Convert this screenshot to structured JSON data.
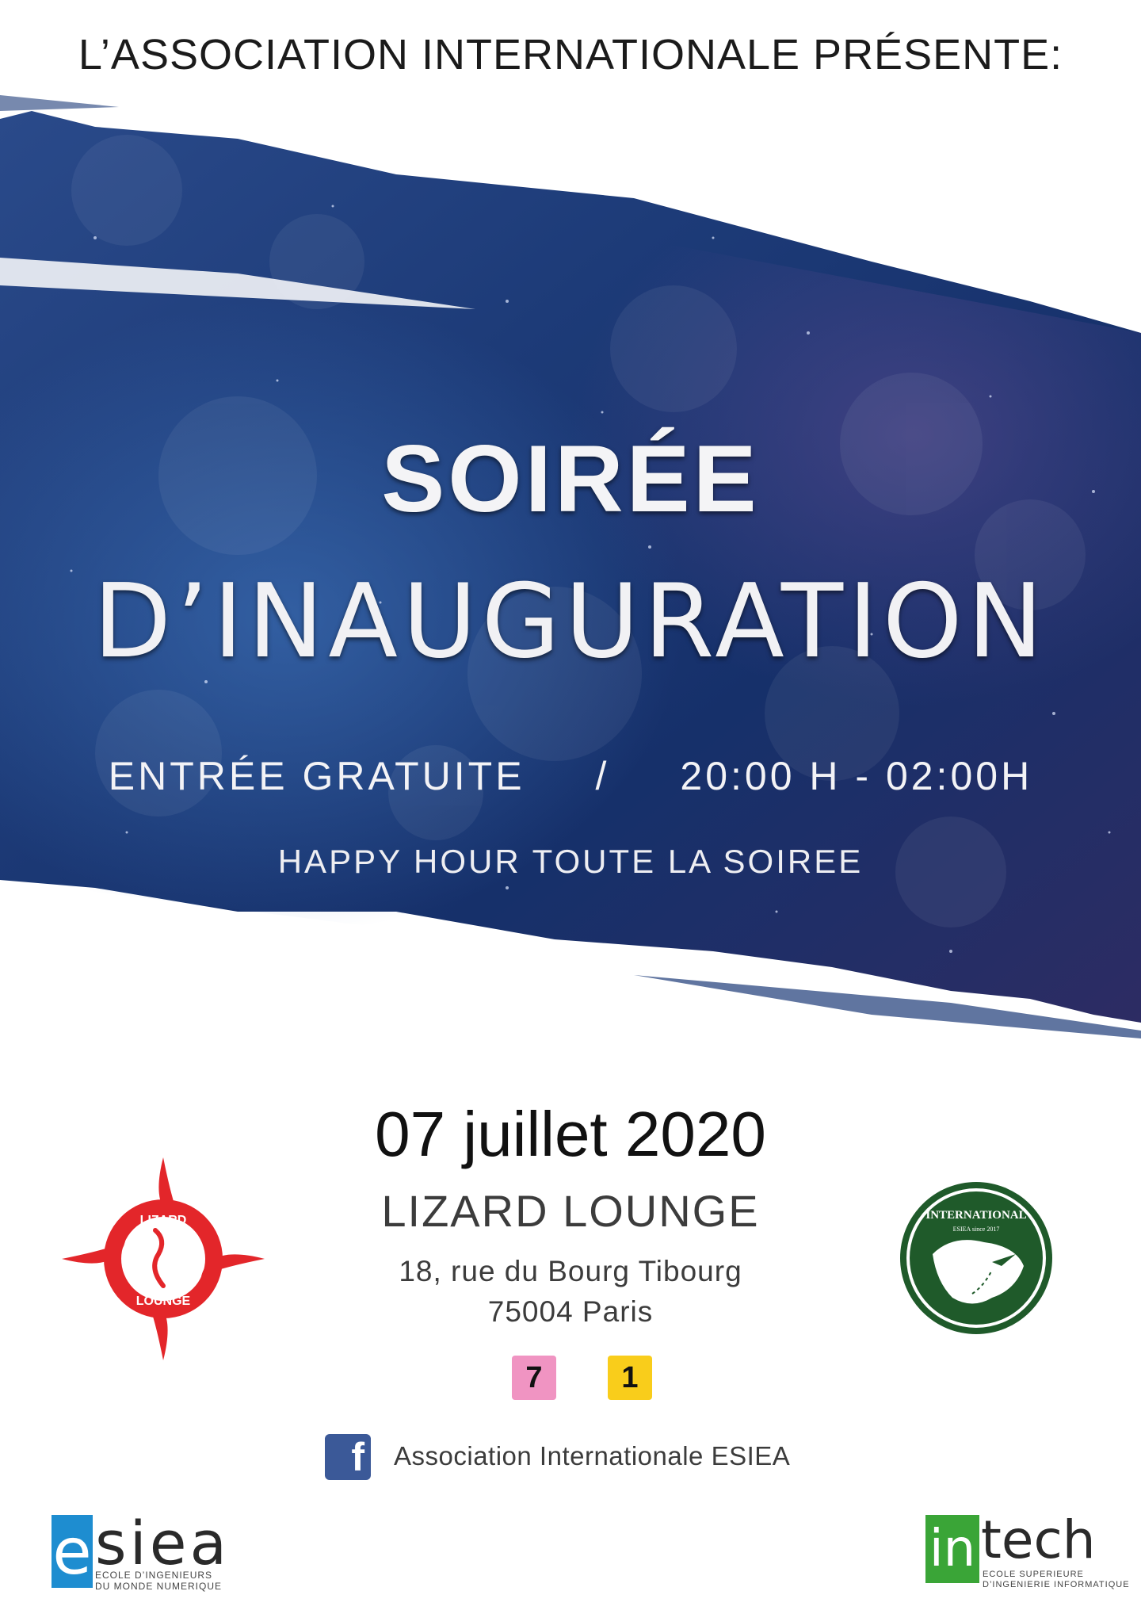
{
  "header": {
    "presenter": "L’ASSOCIATION INTERNATIONALE PRÉSENTE:"
  },
  "event": {
    "title_line1": "SOIRÉE",
    "title_line2": "D’INAUGURATION",
    "entry": "ENTRÉE GRATUITE",
    "separator": "/",
    "hours": "20:00 H - 02:00H",
    "happy_hour": "HAPPY HOUR TOUTE LA SOIREE",
    "date": "07 juillet 2020",
    "venue": "LIZARD LOUNGE",
    "address_line1": "18, rue du Bourg Tibourg",
    "address_line2": "75004 Paris"
  },
  "metro": [
    {
      "line": "7",
      "color": "#f094c2"
    },
    {
      "line": "1",
      "color": "#f9cd1b"
    }
  ],
  "social": {
    "icon": "facebook-icon",
    "label": "Association Internationale ESIEA"
  },
  "logos": {
    "lizard": {
      "top_text": "LIZARD",
      "bottom_text": "LOUNGE",
      "color": "#e3262a"
    },
    "international": {
      "top_text": "INTERNATIONAL",
      "sub_text": "ESIEA since 2017",
      "color": "#1f5a2a"
    },
    "esiea": {
      "mark": "e",
      "word": "siea",
      "tag_line1": "ECOLE D’INGENIEURS",
      "tag_line2": "DU MONDE NUMERIQUE"
    },
    "intech": {
      "mark": "in",
      "word": "tech",
      "tag_line1": "ECOLE SUPERIEURE",
      "tag_line2": "D’INGENIERIE INFORMATIQUE"
    }
  },
  "colors": {
    "banner_dark": "#0f2350",
    "banner_mid": "#2a4d8f",
    "banner_purple": "#3b2f6b"
  }
}
